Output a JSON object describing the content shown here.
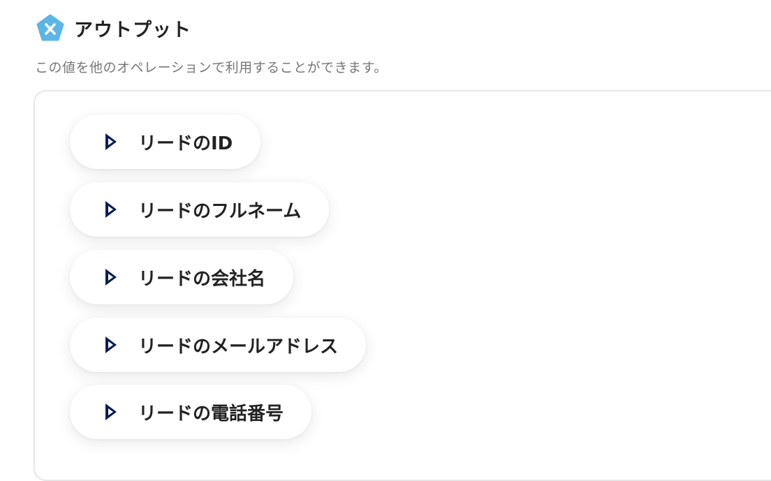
{
  "section": {
    "title": "アウトプット",
    "subtitle": "この値を他のオペレーションで利用することができます。",
    "logo_icon": "yoom-x-pentagon-icon",
    "accent_color": "#5bb6e6"
  },
  "outputs": [
    {
      "label": "リードのID",
      "icon": "dynamics-365-icon"
    },
    {
      "label": "リードのフルネーム",
      "icon": "dynamics-365-icon"
    },
    {
      "label": "リードの会社名",
      "icon": "dynamics-365-icon"
    },
    {
      "label": "リードのメールアドレス",
      "icon": "dynamics-365-icon"
    },
    {
      "label": "リードの電話番号",
      "icon": "dynamics-365-icon"
    }
  ],
  "colors": {
    "icon_dark": "#0b1f4e",
    "text": "#222222",
    "subtext": "#777777"
  }
}
